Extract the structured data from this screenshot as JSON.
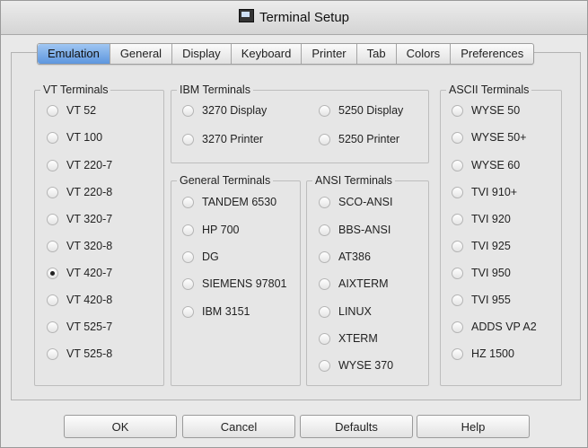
{
  "window": {
    "title": "Terminal Setup",
    "icon": "terminal-icon"
  },
  "tabs": [
    "Emulation",
    "General",
    "Display",
    "Keyboard",
    "Printer",
    "Tab",
    "Colors",
    "Preferences"
  ],
  "active_tab": "Emulation",
  "groups": {
    "vt": {
      "title": "VT Terminals",
      "options": [
        "VT 52",
        "VT 100",
        "VT 220-7",
        "VT 220-8",
        "VT 320-7",
        "VT 320-8",
        "VT 420-7",
        "VT 420-8",
        "VT 525-7",
        "VT 525-8"
      ]
    },
    "ibm": {
      "title": "IBM Terminals",
      "options": [
        "3270 Display",
        "5250 Display",
        "3270 Printer",
        "5250 Printer"
      ]
    },
    "general": {
      "title": "General Terminals",
      "options": [
        "TANDEM 6530",
        "HP 700",
        "DG",
        "SIEMENS 97801",
        "IBM 3151"
      ]
    },
    "ansi": {
      "title": "ANSI Terminals",
      "options": [
        "SCO-ANSI",
        "BBS-ANSI",
        "AT386",
        "AIXTERM",
        "LINUX",
        "XTERM",
        "WYSE 370"
      ]
    },
    "ascii": {
      "title": "ASCII Terminals",
      "options": [
        "WYSE 50",
        "WYSE 50+",
        "WYSE 60",
        "TVI 910+",
        "TVI 920",
        "TVI 925",
        "TVI 950",
        "TVI 955",
        "ADDS VP A2",
        "HZ 1500"
      ]
    }
  },
  "selected": "VT 420-7",
  "buttons": {
    "ok": "OK",
    "cancel": "Cancel",
    "defaults": "Defaults",
    "help": "Help"
  }
}
